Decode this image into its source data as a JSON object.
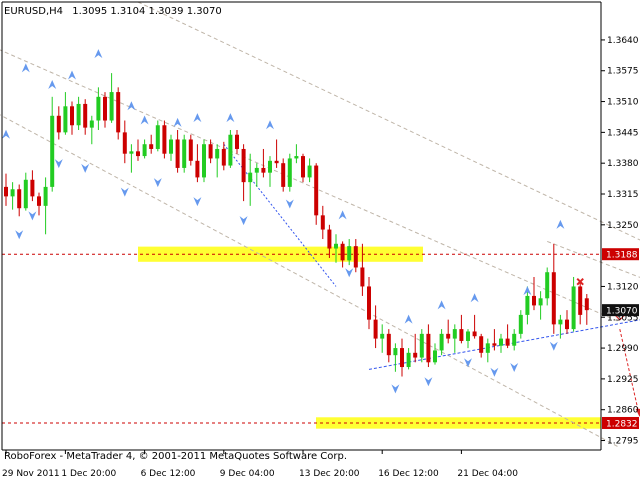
{
  "header": {
    "symbol": "EURUSD,H4",
    "ohlc": "1.3095 1.3104 1.3039 1.3070"
  },
  "footer": {
    "copyright": "RoboForex - MetaTrader 4, © 2001-2011 MetaQuotes Software Corp."
  },
  "colors": {
    "bull": "#22cc22",
    "bear": "#cc0000",
    "zone": "#ffff33",
    "level_line": "#cc0000",
    "trend_line": "#bfb5a8",
    "support_line": "#3355ee",
    "fractal": "#6699ee",
    "forecast": "#dd2222",
    "current_price_bg": "#111111"
  },
  "chart_data": {
    "type": "candlestick",
    "symbol": "EURUSD",
    "timeframe": "H4",
    "ylim": [
      1.2775,
      1.372
    ],
    "y_ticks": [
      "1.3640",
      "1.3575",
      "1.3510",
      "1.3445",
      "1.3380",
      "1.3315",
      "1.3250",
      "1.3120",
      "1.3055",
      "1.2990",
      "1.2925",
      "1.2860",
      "1.2795"
    ],
    "x_ticks": [
      "29 Nov 2011",
      "1 Dec 20:00",
      "6 Dec 12:00",
      "9 Dec 04:00",
      "13 Dec 20:00",
      "16 Dec 12:00",
      "21 Dec 04:00"
    ],
    "candles": [
      [
        1.333,
        1.3358,
        1.329,
        1.331
      ],
      [
        1.331,
        1.334,
        1.3282,
        1.3325
      ],
      [
        1.3325,
        1.3335,
        1.3268,
        1.3285
      ],
      [
        1.3285,
        1.336,
        1.328,
        1.3345
      ],
      [
        1.3345,
        1.3365,
        1.33,
        1.331
      ],
      [
        1.331,
        1.3318,
        1.327,
        1.329
      ],
      [
        1.329,
        1.335,
        1.323,
        1.333
      ],
      [
        1.333,
        1.352,
        1.332,
        1.348
      ],
      [
        1.348,
        1.35,
        1.343,
        1.3445
      ],
      [
        1.3445,
        1.353,
        1.344,
        1.35
      ],
      [
        1.35,
        1.351,
        1.344,
        1.346
      ],
      [
        1.346,
        1.352,
        1.345,
        1.3505
      ],
      [
        1.3505,
        1.3515,
        1.344,
        1.3455
      ],
      [
        1.3455,
        1.348,
        1.342,
        1.347
      ],
      [
        1.347,
        1.354,
        1.345,
        1.352
      ],
      [
        1.352,
        1.353,
        1.3455,
        1.347
      ],
      [
        1.347,
        1.357,
        1.3465,
        1.353
      ],
      [
        1.353,
        1.354,
        1.343,
        1.3445
      ],
      [
        1.3445,
        1.347,
        1.338,
        1.34
      ],
      [
        1.34,
        1.342,
        1.336,
        1.3405
      ],
      [
        1.3405,
        1.343,
        1.3385,
        1.3395
      ],
      [
        1.3395,
        1.343,
        1.339,
        1.342
      ],
      [
        1.342,
        1.344,
        1.34,
        1.341
      ],
      [
        1.341,
        1.347,
        1.3405,
        1.346
      ],
      [
        1.346,
        1.347,
        1.339,
        1.34
      ],
      [
        1.34,
        1.344,
        1.3385,
        1.343
      ],
      [
        1.343,
        1.345,
        1.336,
        1.337
      ],
      [
        1.337,
        1.344,
        1.336,
        1.343
      ],
      [
        1.343,
        1.344,
        1.3375,
        1.3385
      ],
      [
        1.3385,
        1.342,
        1.334,
        1.335
      ],
      [
        1.335,
        1.343,
        1.334,
        1.342
      ],
      [
        1.342,
        1.343,
        1.338,
        1.339
      ],
      [
        1.339,
        1.342,
        1.335,
        1.341
      ],
      [
        1.341,
        1.3425,
        1.3365,
        1.3375
      ],
      [
        1.3375,
        1.345,
        1.337,
        1.344
      ],
      [
        1.344,
        1.345,
        1.34,
        1.341
      ],
      [
        1.341,
        1.342,
        1.33,
        1.334
      ],
      [
        1.334,
        1.34,
        1.329,
        1.336
      ],
      [
        1.336,
        1.338,
        1.333,
        1.337
      ],
      [
        1.337,
        1.341,
        1.335,
        1.336
      ],
      [
        1.336,
        1.3395,
        1.333,
        1.3385
      ],
      [
        1.3385,
        1.343,
        1.337,
        1.338
      ],
      [
        1.338,
        1.339,
        1.332,
        1.333
      ],
      [
        1.333,
        1.34,
        1.332,
        1.339
      ],
      [
        1.339,
        1.342,
        1.338,
        1.3395
      ],
      [
        1.3395,
        1.34,
        1.334,
        1.335
      ],
      [
        1.335,
        1.339,
        1.334,
        1.3375
      ],
      [
        1.3375,
        1.338,
        1.325,
        1.327
      ],
      [
        1.327,
        1.329,
        1.322,
        1.324
      ],
      [
        1.324,
        1.325,
        1.318,
        1.32
      ],
      [
        1.32,
        1.323,
        1.317,
        1.321
      ],
      [
        1.321,
        1.3215,
        1.316,
        1.3175
      ],
      [
        1.3175,
        1.322,
        1.3165,
        1.3205
      ],
      [
        1.3205,
        1.322,
        1.315,
        1.316
      ],
      [
        1.316,
        1.321,
        1.31,
        1.312
      ],
      [
        1.312,
        1.314,
        1.303,
        1.305
      ],
      [
        1.305,
        1.308,
        1.299,
        1.301
      ],
      [
        1.301,
        1.304,
        1.298,
        1.302
      ],
      [
        1.302,
        1.303,
        1.296,
        1.2975
      ],
      [
        1.2975,
        1.3,
        1.294,
        1.299
      ],
      [
        1.299,
        1.301,
        1.293,
        1.295
      ],
      [
        1.295,
        1.299,
        1.2945,
        1.298
      ],
      [
        1.298,
        1.302,
        1.296,
        1.297
      ],
      [
        1.297,
        1.303,
        1.296,
        1.302
      ],
      [
        1.302,
        1.304,
        1.295,
        1.296
      ],
      [
        1.296,
        1.3,
        1.2955,
        1.2985
      ],
      [
        1.2985,
        1.303,
        1.2975,
        1.302
      ],
      [
        1.302,
        1.305,
        1.3,
        1.301
      ],
      [
        1.301,
        1.304,
        1.298,
        1.303
      ],
      [
        1.303,
        1.306,
        1.3,
        1.3005
      ],
      [
        1.3005,
        1.303,
        1.299,
        1.3025
      ],
      [
        1.3025,
        1.306,
        1.301,
        1.3015
      ],
      [
        1.3015,
        1.302,
        1.297,
        1.298
      ],
      [
        1.298,
        1.301,
        1.296,
        1.3
      ],
      [
        1.3,
        1.303,
        1.2985,
        1.2995
      ],
      [
        1.2995,
        1.302,
        1.298,
        1.301
      ],
      [
        1.301,
        1.304,
        1.299,
        1.2995
      ],
      [
        1.2995,
        1.303,
        1.2985,
        1.302
      ],
      [
        1.302,
        1.307,
        1.301,
        1.306
      ],
      [
        1.306,
        1.312,
        1.304,
        1.31
      ],
      [
        1.31,
        1.314,
        1.307,
        1.308
      ],
      [
        1.308,
        1.311,
        1.305,
        1.3095
      ],
      [
        1.3095,
        1.316,
        1.308,
        1.315
      ],
      [
        1.315,
        1.321,
        1.302,
        1.304
      ],
      [
        1.304,
        1.306,
        1.301,
        1.305
      ],
      [
        1.305,
        1.307,
        1.302,
        1.303
      ],
      [
        1.303,
        1.314,
        1.3025,
        1.312
      ],
      [
        1.312,
        1.313,
        1.304,
        1.306
      ],
      [
        1.3095,
        1.3104,
        1.3039,
        1.307
      ]
    ],
    "horizontal_levels": [
      {
        "label": "1.3188",
        "value": 1.3188,
        "zone": [
          1.3172,
          1.3204
        ]
      },
      {
        "label": "1.2832",
        "value": 1.2832,
        "zone": [
          1.282,
          1.2844
        ]
      }
    ],
    "current_price": {
      "label": "1.3070",
      "value": 1.307
    },
    "fractals_up": [
      [
        0,
        1.344
      ],
      [
        3,
        1.358
      ],
      [
        7,
        1.3545
      ],
      [
        10,
        1.3565
      ],
      [
        14,
        1.361
      ],
      [
        19,
        1.35
      ],
      [
        21,
        1.347
      ],
      [
        26,
        1.3465
      ],
      [
        29,
        1.3475
      ],
      [
        34,
        1.3475
      ],
      [
        40,
        1.346
      ],
      [
        51,
        1.327
      ],
      [
        61,
        1.305
      ],
      [
        66,
        1.308
      ],
      [
        71,
        1.3095
      ],
      [
        79,
        1.311
      ],
      [
        84,
        1.325
      ]
    ],
    "fractals_down": [
      [
        2,
        1.323
      ],
      [
        4,
        1.327
      ],
      [
        8,
        1.338
      ],
      [
        12,
        1.337
      ],
      [
        18,
        1.332
      ],
      [
        23,
        1.334
      ],
      [
        29,
        1.33
      ],
      [
        36,
        1.326
      ],
      [
        43,
        1.3295
      ],
      [
        52,
        1.315
      ],
      [
        59,
        1.2905
      ],
      [
        64,
        1.292
      ],
      [
        70,
        1.296
      ],
      [
        74,
        1.294
      ],
      [
        77,
        1.295
      ],
      [
        83,
        1.2995
      ]
    ],
    "diagonal_lines": [
      {
        "style": "dash",
        "points": [
          [
            "-6",
            1.365
          ],
          [
            93,
            1.3045
          ]
        ]
      },
      {
        "style": "dash",
        "points": [
          [
            "-6",
            1.352
          ],
          [
            93,
            1.278
          ]
        ]
      },
      {
        "style": "dash",
        "points": [
          [
            20,
            1.372
          ],
          [
            120,
            1.306
          ]
        ]
      },
      {
        "style": "dash",
        "points": [
          [
            82,
            1.3215
          ],
          [
            120,
            1.301
          ]
        ]
      }
    ],
    "support_line": [
      [
        55,
        1.2945
      ],
      [
        110,
        1.3085
      ]
    ],
    "sell_signal_index": 87,
    "down_arrow_index": 93,
    "forecast_arrow": [
      [
        93,
        1.303
      ],
      [
        96,
        1.2845
      ]
    ]
  }
}
